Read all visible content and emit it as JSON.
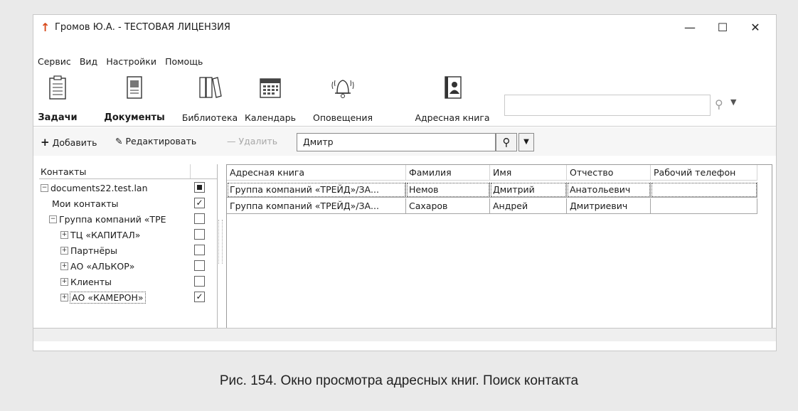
{
  "window": {
    "title": "Громов Ю.А. - ТЕСТОВАЯ ЛИЦЕНЗИЯ",
    "minimize": "—",
    "maximize": "☐",
    "close": "✕"
  },
  "menu": [
    "Сервис",
    "Вид",
    "Настройки",
    "Помощь"
  ],
  "ribbon": [
    {
      "label": "Задачи",
      "icon": "tasks-icon",
      "bold": true
    },
    {
      "label": "Документы",
      "icon": "documents-icon",
      "bold": true
    },
    {
      "label": "Библиотека",
      "icon": "library-icon",
      "bold": false
    },
    {
      "label": "Календарь",
      "icon": "calendar-icon",
      "bold": false
    },
    {
      "label": "Оповещения",
      "icon": "bell-icon",
      "bold": false
    },
    {
      "label": "Адресная книга",
      "icon": "address-book-icon",
      "bold": false
    }
  ],
  "top_search": {
    "value": ""
  },
  "toolbar": {
    "add": "Добавить",
    "edit": "Редактировать",
    "delete": "Удалить",
    "search_value": "Дмитр"
  },
  "tree": {
    "header": "Контакты",
    "items": [
      {
        "label": "documents22.test.lan",
        "expander": "−",
        "check": "filled"
      },
      {
        "label": "Мои контакты",
        "expander": "",
        "check": "checked"
      },
      {
        "label": "Группа компаний «ТРЕ",
        "expander": "−",
        "check": "empty"
      },
      {
        "label": "ТЦ «КАПИТАЛ»",
        "expander": "+",
        "check": "empty"
      },
      {
        "label": "Партнёры",
        "expander": "+",
        "check": "empty"
      },
      {
        "label": "АО «АЛЬКОР»",
        "expander": "+",
        "check": "empty"
      },
      {
        "label": "Клиенты",
        "expander": "+",
        "check": "empty"
      },
      {
        "label": "АО «КАМЕРОН»",
        "expander": "+",
        "check": "checked"
      }
    ]
  },
  "grid": {
    "columns": [
      "Адресная книга",
      "Фамилия",
      "Имя",
      "Отчество",
      "Рабочий телефон"
    ],
    "rows": [
      [
        "Группа компаний «ТРЕЙД»/ЗА...",
        "Немов",
        "Дмитрий",
        "Анатольевич",
        ""
      ],
      [
        "Группа компаний «ТРЕЙД»/ЗА...",
        "Сахаров",
        "Андрей",
        "Дмитриевич",
        ""
      ]
    ]
  },
  "caption": "Рис. 154. Окно просмотра адресных книг. Поиск контакта",
  "colors": {
    "title_icon": "#d84a1b",
    "accent": "#2b6cb0"
  }
}
